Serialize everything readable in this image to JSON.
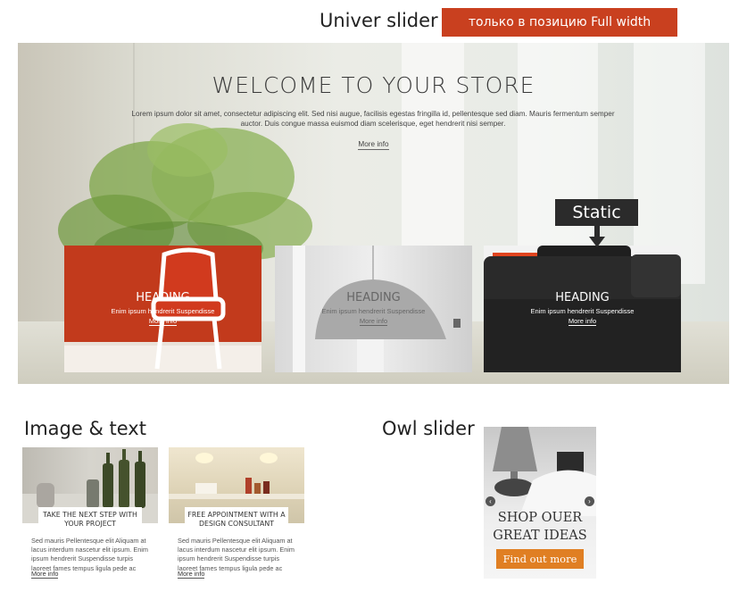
{
  "annotations": {
    "univer_slider": "Univer slider",
    "full_width_badge": "только в позицию Full width",
    "static": "Static",
    "image_text": "Image & text",
    "owl_slider": "Owl slider"
  },
  "hero": {
    "title": "WELCOME TO YOUR STORE",
    "description": "Lorem ipsum dolor sit amet, consectetur adipiscing elit. Sed nisi augue, facilisis egestas fringilla id, pellentesque sed diam. Mauris fermentum semper auctor. Duis congue massa euismod diam scelerisque, eget hendrerit nisi semper.",
    "more": "More info"
  },
  "banners": [
    {
      "heading": "HEADING",
      "text": "Enim ipsum hendrerit Suspendisse",
      "more": "More info"
    },
    {
      "heading": "HEADING",
      "text": "Enim ipsum hendrerit Suspendisse",
      "more": "More info"
    },
    {
      "heading": "HEADING",
      "text": "Enim ipsum hendrerit Suspendisse",
      "more": "More info"
    }
  ],
  "cards": [
    {
      "caption": "TAKE THE NEXT STEP WITH YOUR PROJECT",
      "text": "Sed mauris Pellentesque elit Aliquam at lacus interdum nascetur elit ipsum. Enim ipsum hendrerit Suspendisse turpis laoreet fames tempus ligula pede ac",
      "more": "More info"
    },
    {
      "caption": "FREE APPOINTMENT WITH A DESIGN CONSULTANT",
      "text": "Sed mauris Pellentesque elit Aliquam at lacus interdum nascetur elit ipsum. Enim ipsum hendrerit Suspendisse turpis laoreet fames tempus ligula pede ac",
      "more": "More info"
    }
  ],
  "owl": {
    "text": "SHOP OUER GREAT IDEAS",
    "button": "Find out more",
    "prev_icon": "chevron-left-icon",
    "next_icon": "chevron-right-icon"
  },
  "colors": {
    "badge": "#c9401f",
    "accent_button": "#e07f23",
    "static_label": "#2b2b2b"
  }
}
